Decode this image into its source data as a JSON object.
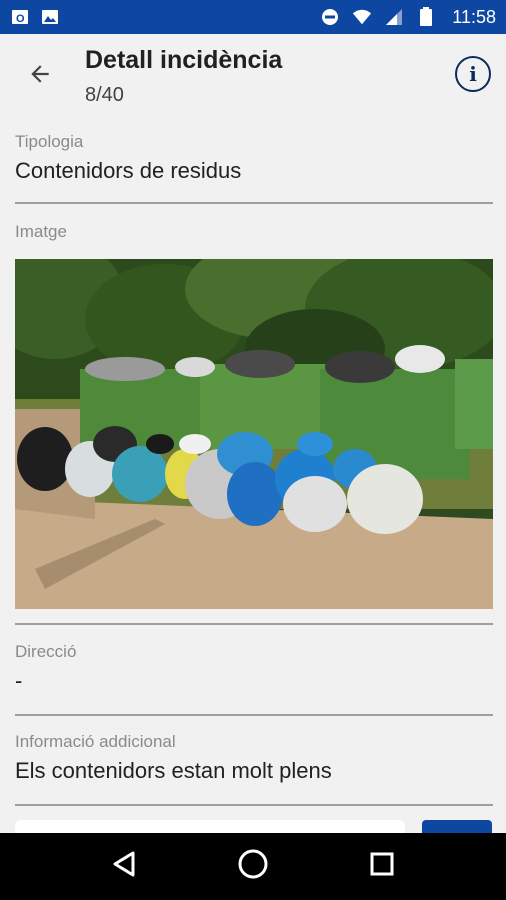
{
  "status_bar": {
    "time": "11:58",
    "icons": [
      "outlook-icon",
      "gallery-icon",
      "do-not-disturb-icon",
      "wifi-icon",
      "signal-icon",
      "battery-icon"
    ],
    "background": "#0d47a1"
  },
  "app_bar": {
    "title": "Detall incidència",
    "subtitle": "8/40"
  },
  "fields": {
    "tipologia": {
      "label": "Tipologia",
      "value": "Contenidors de residus"
    },
    "imatge": {
      "label": "Imatge"
    },
    "direccio": {
      "label": "Direcció",
      "value": "-"
    },
    "info": {
      "label": "Informació addicional",
      "value": "Els contenidors estan molt plens"
    }
  },
  "colors": {
    "accent": "#0d47a1",
    "label": "#8a8a8a",
    "text": "#212121",
    "divider": "#9e9e9e"
  },
  "nav_bar": {
    "buttons": [
      "back-triangle-icon",
      "home-circle-icon",
      "recents-square-icon"
    ]
  }
}
